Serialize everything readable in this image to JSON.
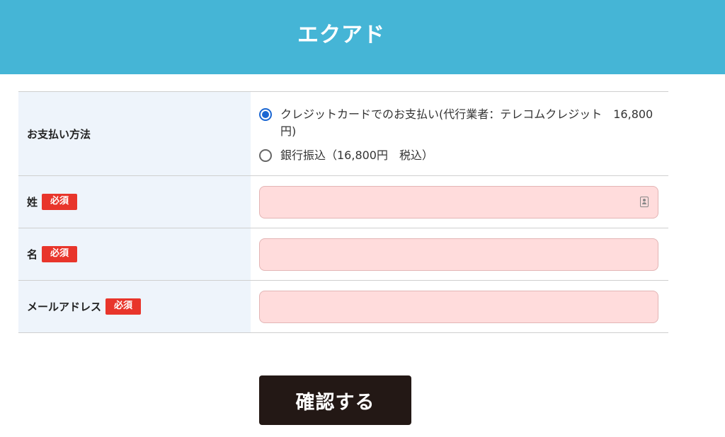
{
  "header": {
    "title": "エクアド",
    "background_color": "#45b5d6"
  },
  "form": {
    "payment": {
      "label": "お支払い方法",
      "options": [
        {
          "label": "クレジットカードでのお支払い(代行業者：テレコムクレジット　16,800円)",
          "checked": true
        },
        {
          "label": "銀行振込（16,800円　税込）",
          "checked": false
        }
      ]
    },
    "last_name": {
      "label": "姓",
      "required_badge": "必須",
      "value": ""
    },
    "first_name": {
      "label": "名",
      "required_badge": "必須",
      "value": ""
    },
    "email": {
      "label": "メールアドレス",
      "required_badge": "必須",
      "value": ""
    },
    "input_background_color": "#ffdcdc",
    "required_badge_color": "#e8352b",
    "radio_selected_color": "#1a66d2"
  },
  "actions": {
    "confirm_label": "確認する",
    "button_color": "#231815"
  },
  "icons": {
    "autofill": "contact-card-icon"
  }
}
